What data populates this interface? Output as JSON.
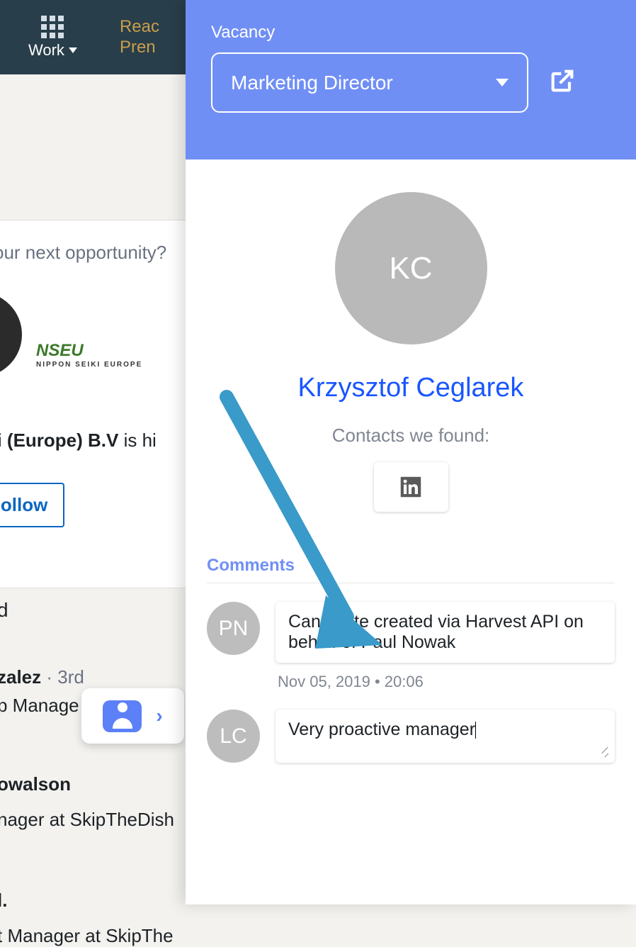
{
  "topbar": {
    "work_label": "Work",
    "premium_label": "Reac\nPren"
  },
  "bg": {
    "opportunity_text": "our next opportunity?",
    "logo_text": "NSEU",
    "logo_sub": "NIPPON SEIKI EUROPE",
    "hiring_bold": "ki (Europe) B.V",
    "hiring_tail": " is hi",
    "follow_label": "Follow",
    "letter_d": "d",
    "name1": "zalez",
    "deg1": " · 3rd",
    "sub1": "p Manage",
    "name2": "owalson",
    "sub2": "nager at SkipTheDish",
    "name3": "l.",
    "sub3": "t Manager at SkipThe"
  },
  "panel": {
    "vacancy_label": "Vacancy",
    "vacancy_value": "Marketing Director",
    "avatar_initials": "KC",
    "candidate_name": "Krzysztof Ceglarek",
    "contacts_label": "Contacts we found:",
    "comments_label": "Comments",
    "comments": [
      {
        "initials": "PN",
        "text": "Candidate created via Harvest API on behalf of Paul Nowak",
        "meta": "Nov 05, 2019 • 20:06"
      },
      {
        "initials": "LC",
        "text": "Very proactive manager"
      }
    ]
  }
}
